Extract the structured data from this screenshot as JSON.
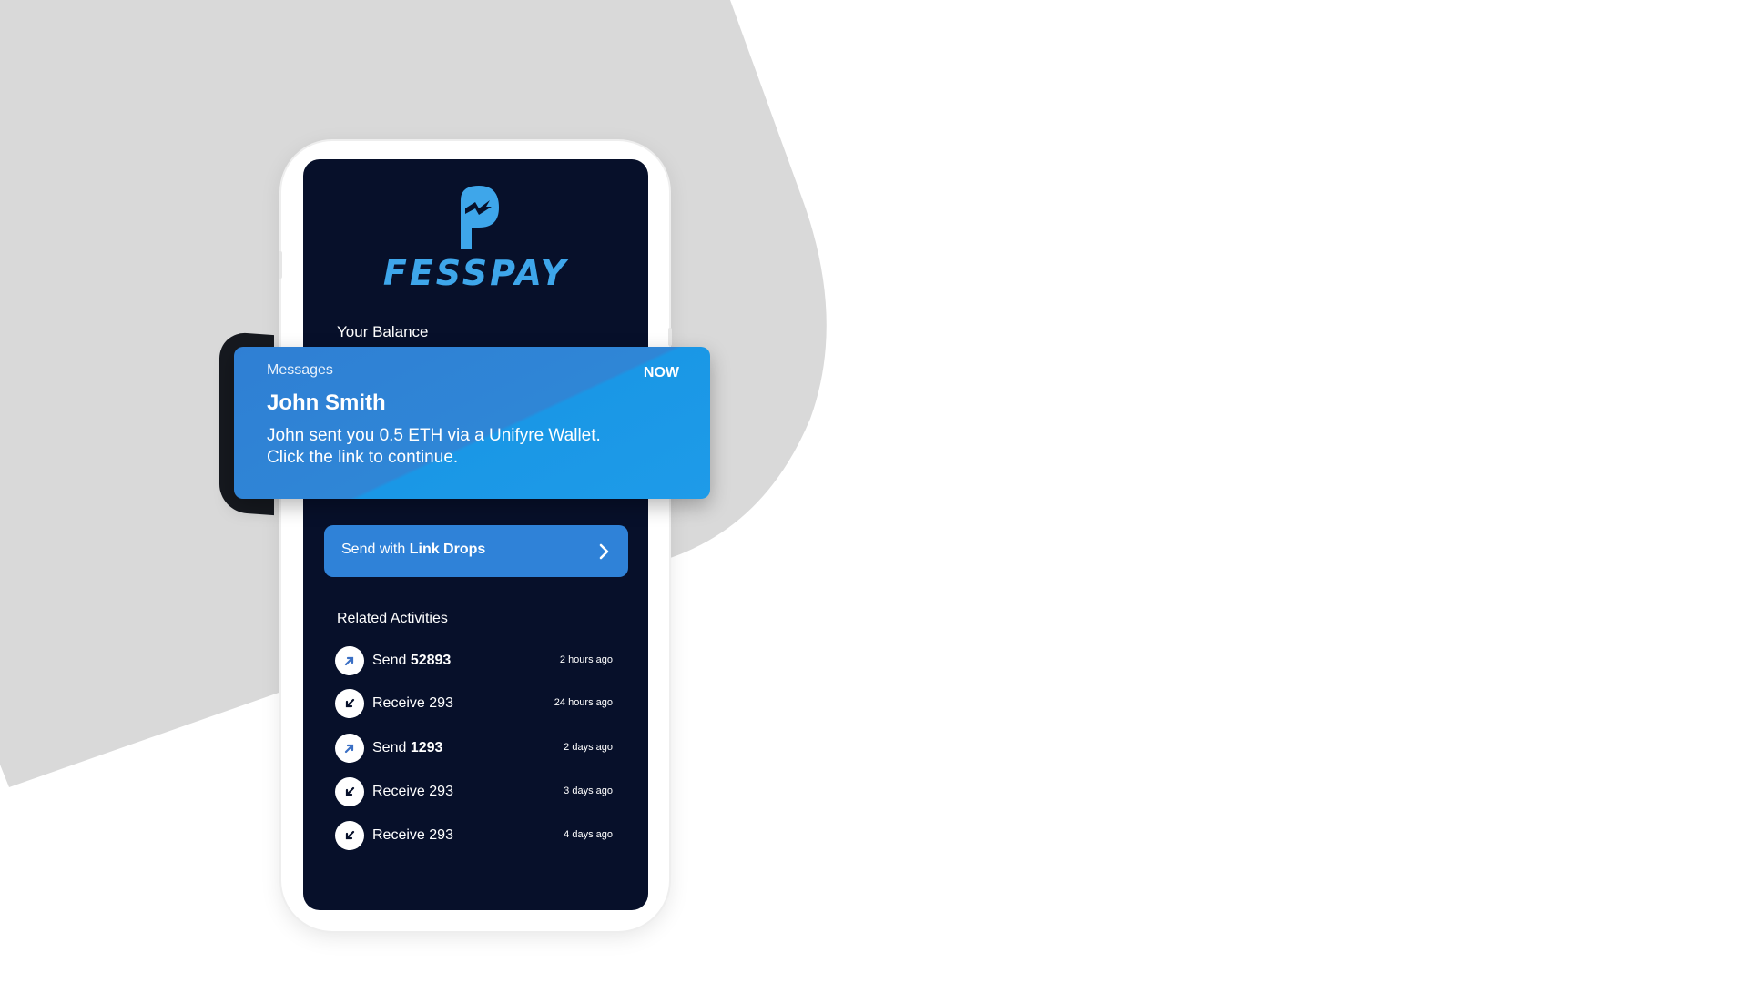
{
  "brand": {
    "name": "FESSPAY",
    "color": "#3ea6ea"
  },
  "wallet": {
    "balance_label": "Your Balance"
  },
  "notification": {
    "app": "Messages",
    "time": "NOW",
    "title": "John Smith",
    "body_line1": "John sent you 0.5 ETH via a Unifyre Wallet.",
    "body_line2": "Click the link to continue."
  },
  "send_button": {
    "prefix": "Send with ",
    "emphasis": "Link Drops",
    "icon": "chevron-right-icon"
  },
  "activities": {
    "title": "Related Activities",
    "items": [
      {
        "type": "Send",
        "amount": "52893",
        "time": "2 hours ago",
        "icon": "arrow-up-right-icon"
      },
      {
        "type": "Receive",
        "amount": "293",
        "time": "24 hours ago",
        "icon": "arrow-down-left-icon"
      },
      {
        "type": "Send",
        "amount": "1293",
        "time": "2 days ago",
        "icon": "arrow-up-right-icon"
      },
      {
        "type": "Receive",
        "amount": "293",
        "time": "3 days ago",
        "icon": "arrow-down-left-icon"
      },
      {
        "type": "Receive",
        "amount": "293",
        "time": "4 days ago",
        "icon": "arrow-down-left-icon"
      }
    ]
  },
  "colors": {
    "screen_bg": "#07102a",
    "notification_bg": "#2f86d6",
    "button_bg": "#2f82d8",
    "backdrop_shape": "#d9d9d9"
  }
}
